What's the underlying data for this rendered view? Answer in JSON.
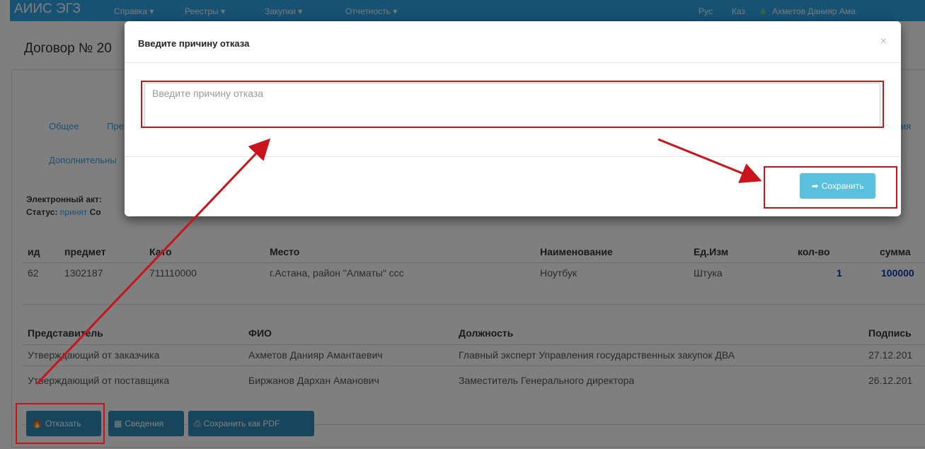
{
  "navbar": {
    "brand": "АИИС ЭГЗ",
    "menu": [
      "Справка ▾",
      "Реестры ▾",
      "Закупки ▾",
      "Отчетность ▾"
    ],
    "lang_ru": "Рус",
    "lang_kz": "Каз",
    "user": "Ахметов Данияр Ама"
  },
  "page": {
    "title": "Договор № 20",
    "tabs": [
      "Общее",
      "Пре",
      "ия"
    ],
    "tab_additional": "Дополнительны",
    "act_label": "Электронный акт:",
    "status_label": "Статус:",
    "status_value": "принят",
    "status_suffix": "Со"
  },
  "items_table": {
    "headers": [
      "ид",
      "предмет",
      "Като",
      "Место",
      "Наименование",
      "Ед.Изм",
      "кол-во",
      "сумма"
    ],
    "rows": [
      [
        "62",
        "1302187",
        "711110000",
        "г.Астана, район \"Алматы\" ссс",
        "Ноутбук",
        "Штука",
        "1",
        "100000"
      ]
    ]
  },
  "signers_table": {
    "headers": [
      "Представитель",
      "ФИО",
      "Должность",
      "Подпись"
    ],
    "rows": [
      [
        "Утверждающий от заказчика",
        "Ахметов Данияр Амантаевич",
        "Главный эксперт Управления государственных закупок ДВА",
        "27.12.201"
      ],
      [
        "Утверждающий от поставщика",
        "Биржанов Дархан Аманович",
        "Заместитель Генерального директора",
        "26.12.201"
      ]
    ]
  },
  "actions": {
    "reject": "Отказать",
    "details": "Сведения",
    "save_pdf": "Сохранить как PDF"
  },
  "modal": {
    "title": "Введите причину отказа",
    "close": "×",
    "placeholder": "Введите причину отказа",
    "save": "Сохранить"
  },
  "colors": {
    "navbar": "#2fa4e7",
    "button": "#2f8ab8",
    "save_button": "#5bc0de",
    "annotation": "#c8141a"
  },
  "icons": [
    "user-icon",
    "fire-icon",
    "grid-icon",
    "print-icon",
    "save-share-icon",
    "close-icon"
  ]
}
